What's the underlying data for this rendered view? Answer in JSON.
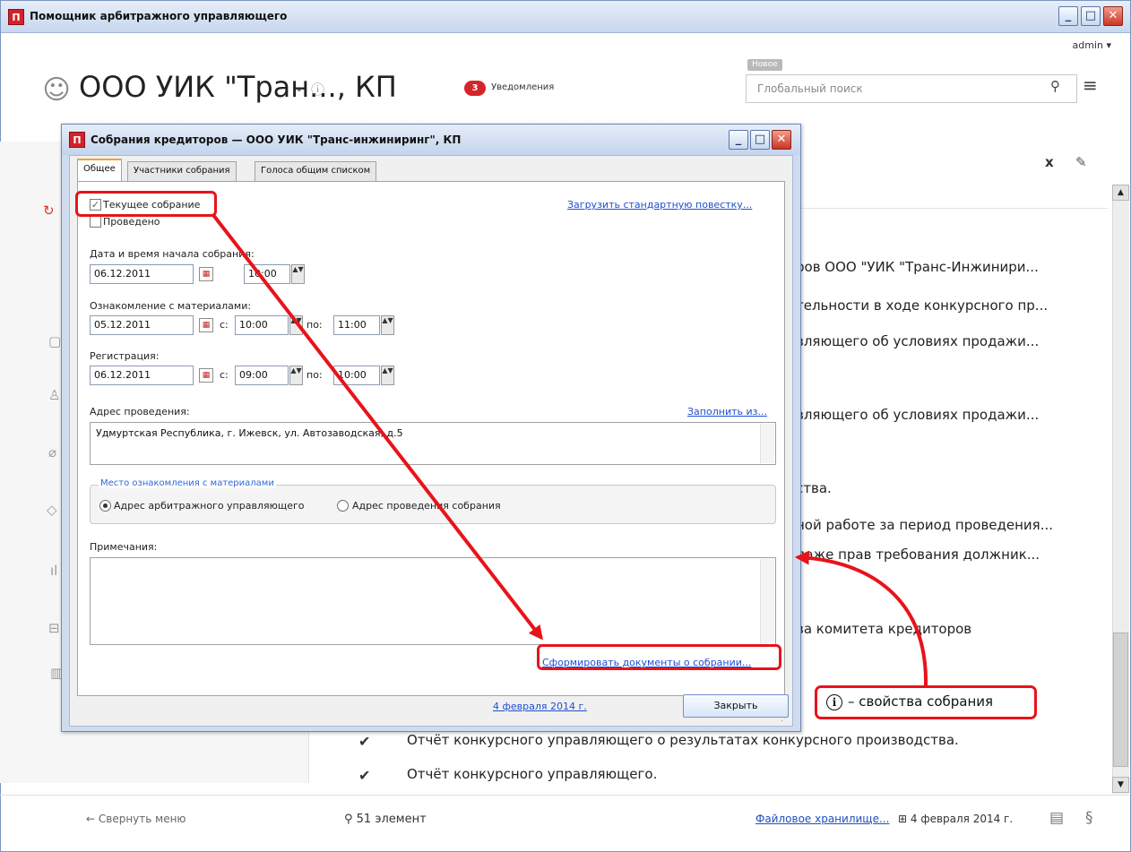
{
  "window": {
    "title": "Помощник арбитражного управляющего",
    "icon": "П",
    "min": "_",
    "max": "□",
    "close": "✕"
  },
  "header": {
    "user": "admin ▾",
    "company": "ООО УИК \"Тран..., КП",
    "chevron": "⌄",
    "info": "ⓘ",
    "notif_count": "3",
    "notif_label": "Уведомления",
    "new_tag": "Новое",
    "search_placeholder": "Глобальный поиск",
    "search_icon": "⚲",
    "menu_icon": "≡",
    "person_icon": "☺"
  },
  "content": {
    "close_x": "x",
    "edit_icon": "✎",
    "rows_partial": [
      "ров ООО \"УИК \"Транс-Инжинири...",
      "тельности в ходе конкурсного пр...",
      "вляющего об условиях продажи...",
      "вляющего об условиях продажи...",
      "ства.",
      "ной работе за период проведения...",
      "даже прав требования должник...",
      "ва комитета кредиторов"
    ],
    "rows_full": [
      "Отчёт конкурсного управляющего о результатах конкурсного производства.",
      "Отчёт конкурсного управляющего."
    ],
    "check": "✔"
  },
  "footer": {
    "collapse": "←  Свернуть меню",
    "count": "⚲  51 элемент",
    "files": "Файловое хранилище...",
    "date": "⊞ 4 февраля 2014 г.",
    "doc_icon": "▤",
    "section_icon": "§"
  },
  "dialog": {
    "title": "Собрания кредиторов — ООО УИК \"Транс-инжиниринг\", КП",
    "tabs": [
      "Общее",
      "Участники собрания",
      "Голоса общим списком"
    ],
    "current_label": "Текущее собрание",
    "current_checked": "✓",
    "held_label": "Проведено",
    "load_agenda": "Загрузить стандартную повестку...",
    "start_label": "Дата и время начала собрания:",
    "start_date": "06.12.2011",
    "start_time": "10:00",
    "review_label": "Ознакомление с материалами:",
    "review_date": "05.12.2011",
    "review_from": "10:00",
    "review_to": "11:00",
    "reg_label": "Регистрация:",
    "reg_date": "06.12.2011",
    "reg_from": "09:00",
    "reg_to": "10:00",
    "from_label": "с:",
    "to_label": "по:",
    "address_label": "Адрес проведения:",
    "fill_from": "Заполнить из...",
    "address": "Удмуртская Республика, г. Ижевск, ул. Автозаводская, д.5",
    "group_title": "Место ознакомления с материалами",
    "radio1": "Адрес арбитражного управляющего",
    "radio2": "Адрес проведения собрания",
    "notes_label": "Примечания:",
    "make_docs": "Сформировать документы о собрании...",
    "date_link": "4 февраля 2014 г.",
    "close_btn": "Закрыть",
    "cal_icon": "▦",
    "spin_icon": "▲▼",
    "scroll_up": "▲",
    "scroll_down": "▼",
    "gripper": "⋰"
  },
  "annotation": {
    "info_symbol": "i",
    "info_text": "– свойства собрания",
    "color": "#e8131a"
  }
}
